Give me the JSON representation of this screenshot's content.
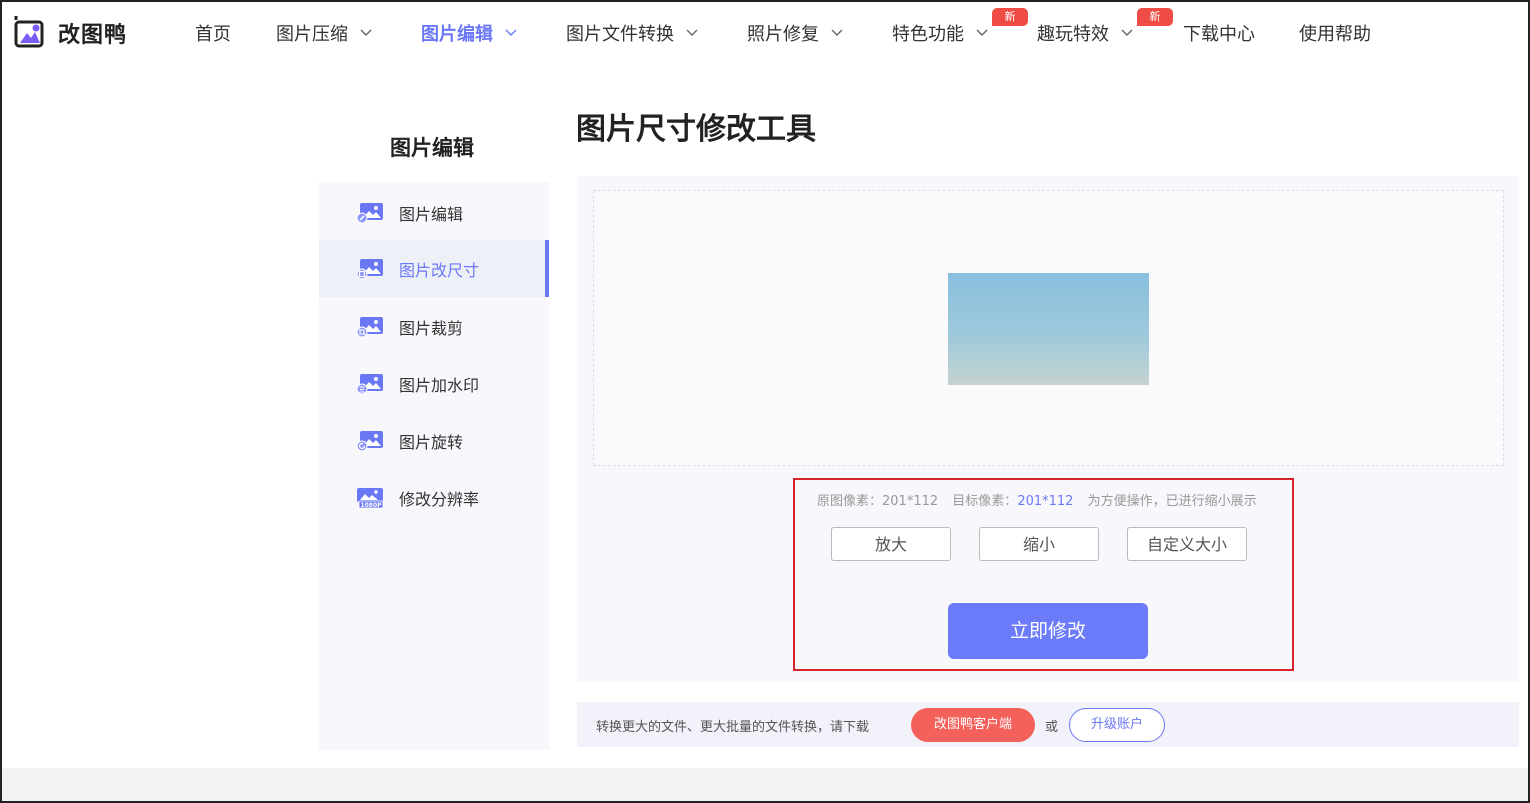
{
  "brand": {
    "name": "改图鸭",
    "accent": "#6b78f5"
  },
  "nav": {
    "items": [
      {
        "label": "首页",
        "dropdown": false,
        "active": false
      },
      {
        "label": "图片压缩",
        "dropdown": true,
        "active": false
      },
      {
        "label": "图片编辑",
        "dropdown": true,
        "active": true
      },
      {
        "label": "图片文件转换",
        "dropdown": true,
        "active": false
      },
      {
        "label": "照片修复",
        "dropdown": true,
        "active": false
      },
      {
        "label": "特色功能",
        "dropdown": true,
        "active": false,
        "badge": "新"
      },
      {
        "label": "趣玩特效",
        "dropdown": true,
        "active": false,
        "badge": "新"
      },
      {
        "label": "下载中心",
        "dropdown": false,
        "active": false
      },
      {
        "label": "使用帮助",
        "dropdown": false,
        "active": false
      }
    ]
  },
  "sidebar": {
    "title": "图片编辑",
    "items": [
      {
        "label": "图片编辑",
        "icon": "image-edit-icon",
        "active": false
      },
      {
        "label": "图片改尺寸",
        "icon": "image-resize-icon",
        "active": true
      },
      {
        "label": "图片裁剪",
        "icon": "image-crop-icon",
        "active": false
      },
      {
        "label": "图片加水印",
        "icon": "image-watermark-icon",
        "active": false
      },
      {
        "label": "图片旋转",
        "icon": "image-rotate-icon",
        "active": false
      },
      {
        "label": "修改分辨率",
        "icon": "resolution-1080p-icon",
        "active": false
      }
    ]
  },
  "main": {
    "title": "图片尺寸修改工具",
    "info": {
      "original_label": "原图像素：",
      "original_value": "201*112",
      "target_label": "目标像素：",
      "target_value": "201*112",
      "note": "为方便操作，已进行缩小展示"
    },
    "buttons": {
      "enlarge": "放大",
      "shrink": "缩小",
      "custom": "自定义大小",
      "apply": "立即修改"
    }
  },
  "bottom": {
    "text": "转换更大的文件、更大批量的文件转换，请下载",
    "client_button": "改图鸭客户端",
    "or": "或",
    "upgrade_button": "升级账户"
  },
  "colors": {
    "accent": "#6b78f5",
    "badge": "#f04c46",
    "primary_button": "#6b7bfa",
    "client_button": "#f4605a",
    "highlight_border": "#d8252b"
  }
}
